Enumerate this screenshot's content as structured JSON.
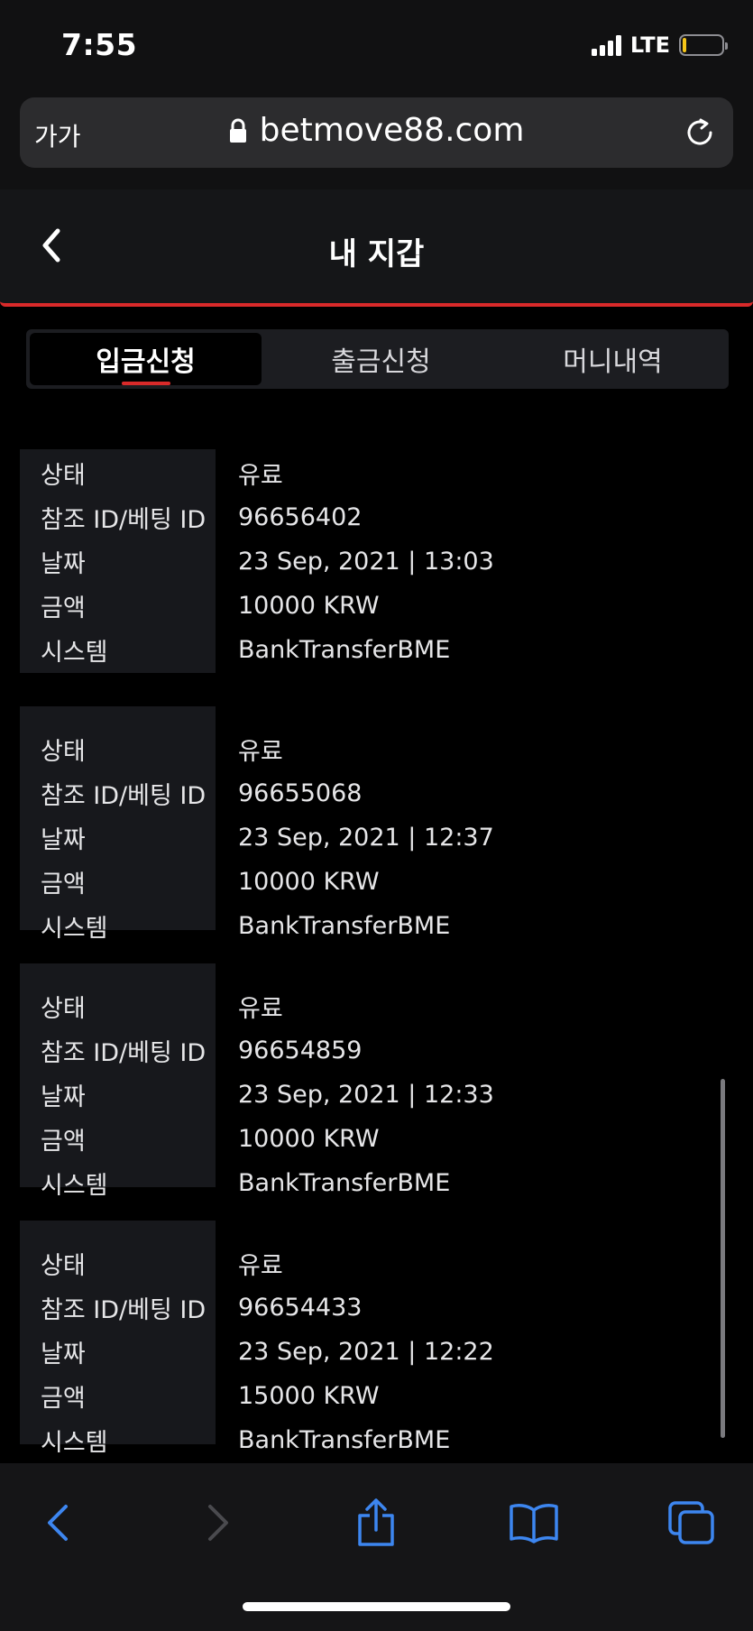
{
  "status": {
    "time": "7:55",
    "network": "LTE"
  },
  "browser": {
    "text_size_label": "가가",
    "url": "betmove88.com"
  },
  "header": {
    "title": "내 지갑"
  },
  "tabs": [
    {
      "label": "입금신청",
      "active": true
    },
    {
      "label": "출금신청",
      "active": false
    },
    {
      "label": "머니내역",
      "active": false
    }
  ],
  "labels": {
    "status": "상태",
    "ref_id": "참조 ID/베팅 ID",
    "date": "날짜",
    "amount": "금액",
    "system": "시스템"
  },
  "records": [
    {
      "status": "유료",
      "ref_id": "96656402",
      "date": "23 Sep, 2021 | 13:03",
      "amount": "10000 KRW",
      "system": "BankTransferBME"
    },
    {
      "status": "유료",
      "ref_id": "96655068",
      "date": "23 Sep, 2021 | 12:37",
      "amount": "10000 KRW",
      "system": "BankTransferBME"
    },
    {
      "status": "유료",
      "ref_id": "96654859",
      "date": "23 Sep, 2021 | 12:33",
      "amount": "10000 KRW",
      "system": "BankTransferBME"
    },
    {
      "status": "유료",
      "ref_id": "96654433",
      "date": "23 Sep, 2021 | 12:22",
      "amount": "15000 KRW",
      "system": "BankTransferBME"
    }
  ],
  "colors": {
    "accent": "#d92a2a",
    "toolbar_icon": "#3d86f0"
  },
  "icons": {
    "header_back": "chevron-left-icon",
    "toolbar": [
      "back-icon",
      "forward-icon",
      "share-icon",
      "bookmarks-icon",
      "tabs-icon"
    ]
  }
}
